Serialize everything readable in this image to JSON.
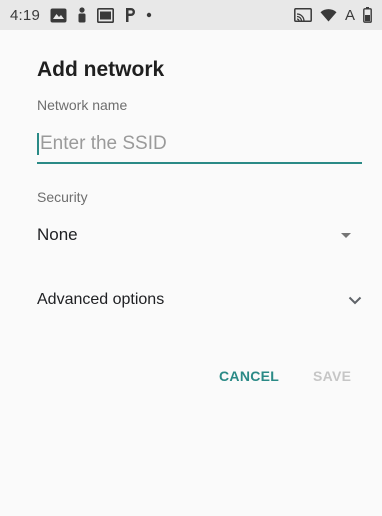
{
  "status_bar": {
    "time": "4:19",
    "icons_left": [
      "photos-notification-icon",
      "person-notification-icon",
      "image-notification-icon",
      "parking-notification-icon",
      "dot-icon"
    ],
    "network_type": "A",
    "icons_right": [
      "cast-icon",
      "wifi-icon",
      "network-type-label",
      "battery-icon"
    ]
  },
  "dialog": {
    "title": "Add network",
    "network_name_label": "Network name",
    "ssid_placeholder": "Enter the SSID",
    "ssid_value": "",
    "security_label": "Security",
    "security_value": "None",
    "advanced_label": "Advanced options",
    "cancel_label": "CANCEL",
    "save_label": "SAVE"
  },
  "colors": {
    "accent": "#2a8a86",
    "disabled": "#c6c6c6",
    "statusbar_bg": "#e8e8e8"
  }
}
